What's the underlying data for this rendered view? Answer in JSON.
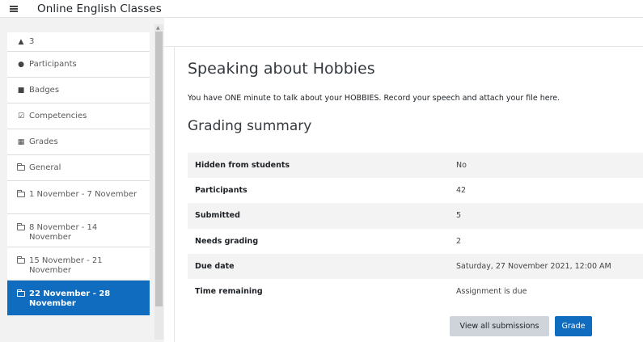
{
  "header": {
    "site_name": "Online English Classes"
  },
  "icons": {
    "menu": "hamburger-icon",
    "course": "graduation-cap-icon",
    "participants": "users-icon",
    "badges": "shield-icon",
    "competencies": "checkbox-icon",
    "grades": "table-icon",
    "section": "folder-icon"
  },
  "colors": {
    "accent": "#0f6cbf",
    "drawer_bg": "#f2f2f2",
    "row_stripe": "#f3f3f3"
  },
  "drawer": {
    "items": [
      {
        "label": "3"
      },
      {
        "label": "Participants"
      },
      {
        "label": "Badges"
      },
      {
        "label": "Competencies"
      },
      {
        "label": "Grades"
      },
      {
        "label": "General"
      },
      {
        "label": "1 November - 7 November"
      },
      {
        "label": "8 November - 14 November"
      },
      {
        "label": "15 November - 21 November"
      },
      {
        "label": "22 November - 28 November",
        "active": true
      }
    ]
  },
  "assignment": {
    "title": "Speaking about Hobbies",
    "intro": "You have ONE minute to talk about your HOBBIES.  Record your speech and attach your file here.",
    "summary_heading": "Grading summary",
    "rows": [
      {
        "label": "Hidden from students",
        "value": "No"
      },
      {
        "label": "Participants",
        "value": "42"
      },
      {
        "label": "Submitted",
        "value": "5"
      },
      {
        "label": "Needs grading",
        "value": "2"
      },
      {
        "label": "Due date",
        "value": "Saturday, 27 November 2021, 12:00 AM"
      },
      {
        "label": "Time remaining",
        "value": "Assignment is due"
      }
    ],
    "buttons": {
      "view_all": "View all submissions",
      "grade": "Grade"
    }
  }
}
